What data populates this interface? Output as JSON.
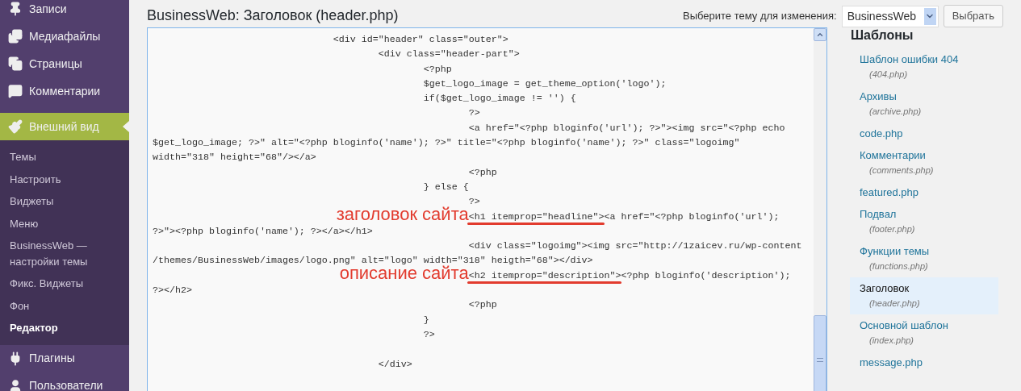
{
  "sidebar": {
    "items": [
      {
        "label": "Записи",
        "kind": "posts",
        "selected": false
      },
      {
        "label": "Медиафайлы",
        "kind": "media",
        "selected": false
      },
      {
        "label": "Страницы",
        "kind": "pages",
        "selected": false
      },
      {
        "label": "Комментарии",
        "kind": "comments",
        "selected": false
      },
      {
        "label": "Внешний вид",
        "kind": "appearance",
        "selected": true,
        "children": [
          {
            "label": "Темы",
            "selected": false
          },
          {
            "label": "Настроить",
            "selected": false
          },
          {
            "label": "Виджеты",
            "selected": false
          },
          {
            "label": "Меню",
            "selected": false
          },
          {
            "label": "BusinessWeb — настройки темы",
            "selected": false
          },
          {
            "label": "Фикс. Виджеты",
            "selected": false
          },
          {
            "label": "Фон",
            "selected": false
          },
          {
            "label": "Редактор",
            "selected": true
          }
        ]
      },
      {
        "label": "Плагины",
        "kind": "plugins",
        "selected": false
      },
      {
        "label": "Пользователи",
        "kind": "users",
        "selected": false
      }
    ]
  },
  "header": {
    "title": "BusinessWeb: Заголовок (header.php)",
    "theme_picker": {
      "label": "Выберите тему для изменения:",
      "value": "BusinessWeb",
      "button": "Выбрать"
    }
  },
  "editor": {
    "lines": [
      {
        "text": "\t\t\t\t<div id=\"header\" class=\"outer\">"
      },
      {
        "text": "\t\t\t\t\t<div class=\"header-part\">"
      },
      {
        "text": "\t\t\t\t\t\t<?php"
      },
      {
        "text": "\t\t\t\t\t\t$get_logo_image = get_theme_option('logo');"
      },
      {
        "text": "\t\t\t\t\t\tif($get_logo_image != '') {"
      },
      {
        "text": "\t\t\t\t\t\t\t?>"
      },
      {
        "text": "\t\t\t\t\t\t\t<a href=\"<?php bloginfo('url'); ?>\"><img src=\"<?php echo"
      },
      {
        "text": "$get_logo_image; ?>\" alt=\"<?php bloginfo('name'); ?>\" title=\"<?php bloginfo('name'); ?>\" class=\"logoimg\""
      },
      {
        "text": "width=\"318\" height=\"68\"/></a>"
      },
      {
        "text": "\t\t\t\t\t\t\t<?php"
      },
      {
        "text": "\t\t\t\t\t\t} else {"
      },
      {
        "text": "\t\t\t\t\t\t\t?>"
      },
      {
        "marked": "\t\t\t\t\t\t\t<h1 itemprop=\"headline\">",
        "text": "<a href=\"<?php bloginfo('url');",
        "note": "заголовок сайта"
      },
      {
        "text": "?>\"><?php bloginfo('name'); ?></a></h1>"
      },
      {
        "text": "\t\t\t\t\t\t\t<div class=\"logoimg\"><img src=\"http://1zaicev.ru/wp-content"
      },
      {
        "text": "/themes/BusinessWeb/images/logo.png\" alt=\"logo\" width=\"318\" heigth=\"68\"></div>"
      },
      {
        "marked": "\t\t\t\t\t\t\t<h2 itemprop=\"description\">",
        "text": "<?php bloginfo('description');",
        "note": "описание сайта"
      },
      {
        "text": "?></h2>"
      },
      {
        "text": "\t\t\t\t\t\t\t<?php"
      },
      {
        "text": "\t\t\t\t\t\t}"
      },
      {
        "text": "\t\t\t\t\t\t?>"
      },
      {
        "blank": true
      },
      {
        "text": "\t\t\t\t\t</div>"
      }
    ]
  },
  "templates": {
    "title": "Шаблоны",
    "items": [
      {
        "label": "Шаблон ошибки 404",
        "file": "(404.php)",
        "selected": false
      },
      {
        "label": "Архивы",
        "file": "(archive.php)",
        "selected": false
      },
      {
        "label": "code.php",
        "selected": false
      },
      {
        "label": "Комментарии",
        "file": "(comments.php)",
        "selected": false
      },
      {
        "label": "featured.php",
        "selected": false
      },
      {
        "label": "Подвал",
        "file": "(footer.php)",
        "selected": false
      },
      {
        "label": "Функции темы",
        "file": "(functions.php)",
        "selected": false
      },
      {
        "label": "Заголовок",
        "file": "(header.php)",
        "selected": true
      },
      {
        "label": "Основной шаблон",
        "file": "(index.php)",
        "selected": false
      },
      {
        "label": "message.php",
        "selected": false
      }
    ]
  }
}
